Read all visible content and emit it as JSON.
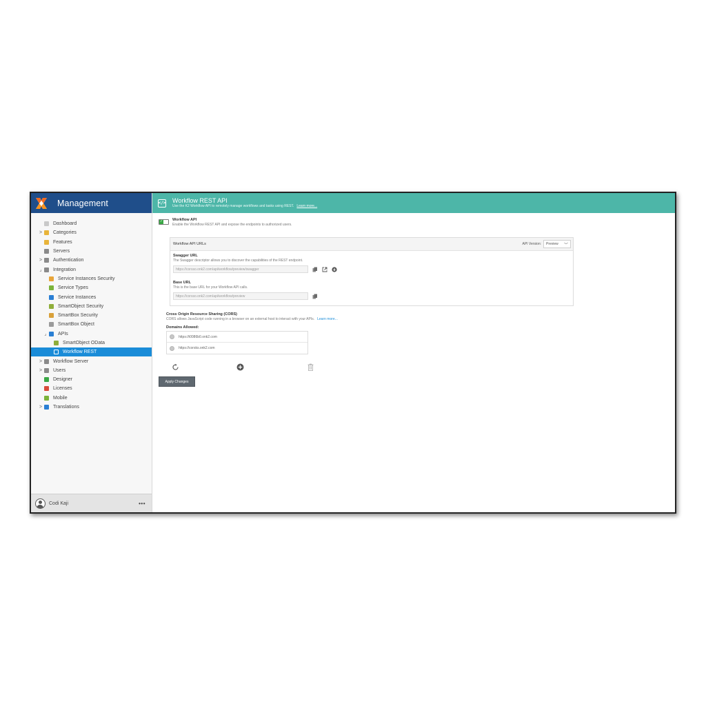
{
  "app": {
    "title": "Management"
  },
  "nav": {
    "items": [
      {
        "label": "Dashboard",
        "icon": "home-icon",
        "color": "#c9c9c9",
        "expander": "",
        "indent": 0
      },
      {
        "label": "Categories",
        "icon": "folder-icon",
        "color": "#e8b43a",
        "expander": ">",
        "indent": 0
      },
      {
        "label": "Features",
        "icon": "features-icon",
        "color": "#e8b43a",
        "expander": "",
        "indent": 0
      },
      {
        "label": "Servers",
        "icon": "server-icon",
        "color": "#8a8a8a",
        "expander": "",
        "indent": 0
      },
      {
        "label": "Authentication",
        "icon": "key-icon",
        "color": "#8a8a8a",
        "expander": ">",
        "indent": 0
      },
      {
        "label": "Integration",
        "icon": "puzzle-icon",
        "color": "#8a8a8a",
        "expander": "⌟",
        "indent": 0
      },
      {
        "label": "Service Instances Security",
        "icon": "lock-icon",
        "color": "#e8a53a",
        "expander": "",
        "indent": 1
      },
      {
        "label": "Service Types",
        "icon": "service-types-icon",
        "color": "#7bb33a",
        "expander": "",
        "indent": 1
      },
      {
        "label": "Service Instances",
        "icon": "service-instances-icon",
        "color": "#2a7fd4",
        "expander": "",
        "indent": 1
      },
      {
        "label": "SmartObject Security",
        "icon": "smartobject-security-icon",
        "color": "#8fae3a",
        "expander": "",
        "indent": 1
      },
      {
        "label": "SmartBox Security",
        "icon": "smartbox-security-icon",
        "color": "#d9a13a",
        "expander": "",
        "indent": 1
      },
      {
        "label": "SmartBox Object",
        "icon": "smartbox-object-icon",
        "color": "#9a9a9a",
        "expander": "",
        "indent": 1
      },
      {
        "label": "APIs",
        "icon": "api-icon",
        "color": "#2a7fd4",
        "expander": "⌟",
        "indent": 1
      },
      {
        "label": "SmartObject OData",
        "icon": "odata-icon",
        "color": "#8fae3a",
        "expander": "",
        "indent": 2
      },
      {
        "label": "Workflow REST",
        "icon": "rest-icon",
        "color": "#ffffff",
        "expander": "",
        "indent": 2,
        "selected": true
      },
      {
        "label": "Workflow Server",
        "icon": "workflow-server-icon",
        "color": "#8a8a8a",
        "expander": ">",
        "indent": 0
      },
      {
        "label": "Users",
        "icon": "users-icon",
        "color": "#8a8a8a",
        "expander": ">",
        "indent": 0
      },
      {
        "label": "Designer",
        "icon": "designer-icon",
        "color": "#3aa845",
        "expander": "",
        "indent": 0
      },
      {
        "label": "Licenses",
        "icon": "license-icon",
        "color": "#d94a3a",
        "expander": "",
        "indent": 0
      },
      {
        "label": "Mobile",
        "icon": "mobile-icon",
        "color": "#7bb33a",
        "expander": "",
        "indent": 0
      },
      {
        "label": "Translations",
        "icon": "globe-icon",
        "color": "#2a7fd4",
        "expander": ">",
        "indent": 0
      }
    ]
  },
  "user": {
    "name": "Codi Kaji",
    "menu": "•••"
  },
  "header": {
    "title": "Workflow REST API",
    "subtitle": "Use the K2 Workflow API to remotely manage workflows and tasks using REST.",
    "link": "Learn more..."
  },
  "workflow_api": {
    "title": "Workflow API",
    "desc": "Enable the Workflow REST API and expose the endpoints to authorized users.",
    "enabled": true
  },
  "urls_panel": {
    "title": "Workflow API URLs",
    "api_version_label": "API Version:",
    "api_version_value": "Preview",
    "swagger": {
      "label": "Swagger URL",
      "desc": "The Swagger descriptor allows you to discover the capabilities of the REST endpoint.",
      "value": "https://corsso.onk2.com/api/workflow/preview/swagger"
    },
    "base": {
      "label": "Base URL",
      "desc": "This is the base URL for your Workflow API calls.",
      "value": "https://corsso.onk2.com/api/workflow/preview"
    }
  },
  "cors": {
    "title": "Cross Origin Resource Sharing (CORS)",
    "desc": "CORS allows JavaScript code running in a browser on an external host to interact with your APIs.",
    "link": "Learn more...",
    "domains_label": "Domains Allowed:",
    "domains": [
      "https://i0086b0.onk2.com",
      "https://corsks.onk2.com"
    ]
  },
  "actions": {
    "apply_label": "Apply Changes"
  },
  "colors": {
    "brand": "#1f4e8a",
    "header": "#4db6a8",
    "selected": "#1a8cd8",
    "toggle_on": "#3aa845"
  }
}
